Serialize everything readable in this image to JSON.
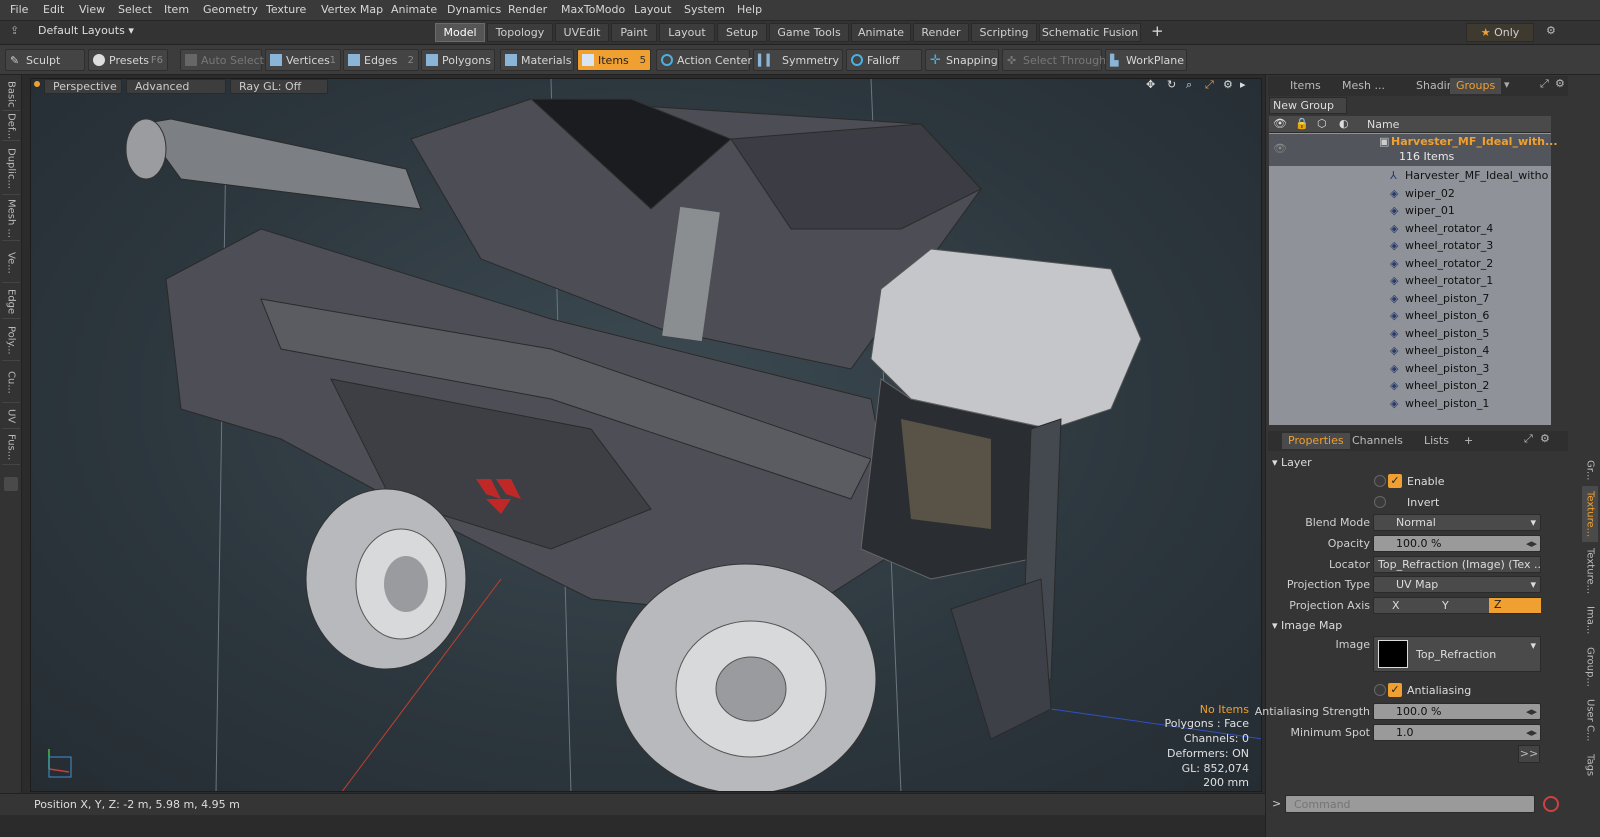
{
  "menu": [
    "File",
    "Edit",
    "View",
    "Select",
    "Item",
    "Geometry",
    "Texture",
    "Vertex Map",
    "Animate",
    "Dynamics",
    "Render",
    "MaxToModo",
    "Layout",
    "System",
    "Help"
  ],
  "layout_selector": "Default Layouts",
  "layout_tabs": [
    "Model",
    "Topology",
    "UVEdit",
    "Paint",
    "Layout",
    "Setup",
    "Game Tools",
    "Animate",
    "Render",
    "Scripting",
    "Schematic Fusion"
  ],
  "layout_add": "+",
  "only_label": "Only",
  "toolbar": {
    "sculpt": "Sculpt",
    "presets": "Presets",
    "presets_key": "F6",
    "auto_select": "Auto Select",
    "vertices": "Vertices",
    "vertices_key": "1",
    "edges": "Edges",
    "edges_key": "2",
    "polygons": "Polygons",
    "materials": "Materials",
    "items": "Items",
    "items_key": "5",
    "action_center": "Action Center",
    "symmetry": "Symmetry",
    "falloff": "Falloff",
    "snapping": "Snapping",
    "select_through": "Select Through",
    "workplane": "WorkPlane"
  },
  "left_tabs": [
    "Basic",
    "Def...",
    "Duplic...",
    "Mesh ...",
    "Ve...",
    "Edge",
    "Poly...",
    "Cu...",
    "UV",
    "Fus..."
  ],
  "viewport": {
    "view": "Perspective",
    "shading": "Advanced",
    "raygl": "Ray GL: Off",
    "info": [
      "No Items",
      "Polygons : Face",
      "Channels: 0",
      "Deformers: ON",
      "GL: 852,074",
      "200 mm"
    ]
  },
  "status": {
    "position": "Position X, Y, Z:  -2 m, 5.98 m, 4.95 m"
  },
  "item_panel": {
    "tabs": [
      "Items",
      "Mesh ...",
      "Shading",
      "Groups"
    ],
    "active_tab": "Groups",
    "new_group": "New Group",
    "column_name": "Name",
    "group_name": "Harvester_MF_Ideal_with...",
    "group_count": "116 Items",
    "items": [
      "Harvester_MF_Ideal_witho ...",
      "wiper_02",
      "wiper_01",
      "wheel_rotator_4",
      "wheel_rotator_3",
      "wheel_rotator_2",
      "wheel_rotator_1",
      "wheel_piston_7",
      "wheel_piston_6",
      "wheel_piston_5",
      "wheel_piston_4",
      "wheel_piston_3",
      "wheel_piston_2",
      "wheel_piston_1"
    ]
  },
  "properties": {
    "tabs": [
      "Properties",
      "Channels",
      "Lists"
    ],
    "add_tab": "+",
    "section_layer": "Layer",
    "enable": "Enable",
    "invert": "Invert",
    "blend_mode_label": "Blend Mode",
    "blend_mode": "Normal",
    "opacity_label": "Opacity",
    "opacity": "100.0 %",
    "locator_label": "Locator",
    "locator": "Top_Refraction (Image) (Tex ...",
    "projection_type_label": "Projection Type",
    "projection_type": "UV Map",
    "projection_axis_label": "Projection Axis",
    "axis_x": "X",
    "axis_y": "Y",
    "axis_z": "Z",
    "section_image_map": "Image Map",
    "image_label": "Image",
    "image": "Top_Refraction",
    "antialiasing": "Antialiasing",
    "aa_strength_label": "Antialiasing Strength",
    "aa_strength": "100.0 %",
    "min_spot_label": "Minimum Spot",
    "min_spot": "1.0",
    "more": ">>"
  },
  "right_tabs": [
    "Gr...",
    "Texture...",
    "Texture...",
    "Ima...",
    "Group...",
    "User C...",
    "Tags"
  ],
  "command": {
    "prompt": ">",
    "placeholder": "Command"
  },
  "colors": {
    "accent": "#f0a030",
    "panel": "#353535",
    "viewport_bg": "#2c363d"
  }
}
